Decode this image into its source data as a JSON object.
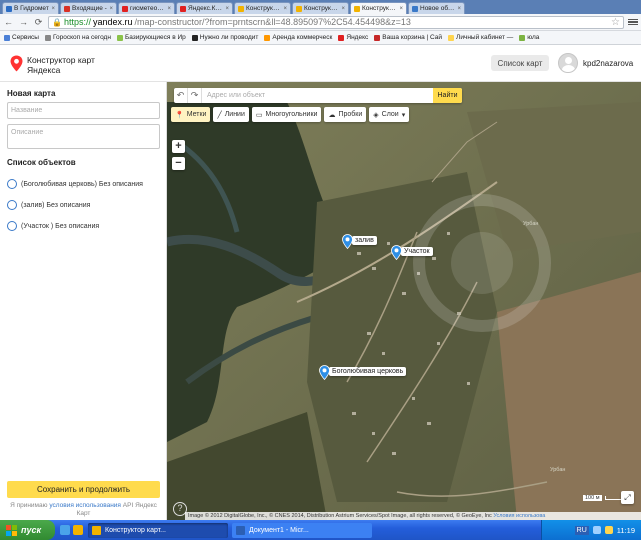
{
  "browser": {
    "tabs": [
      {
        "title": "В Гидромет",
        "favicon_color": "#2b6cc4",
        "active": false
      },
      {
        "title": "Входящие - ",
        "favicon_color": "#d93025",
        "active": false
      },
      {
        "title": "гисметео ул",
        "favicon_color": "#e02020",
        "active": false
      },
      {
        "title": "Яндекс.Карт",
        "favicon_color": "#e02020",
        "active": false
      },
      {
        "title": "Конструктор",
        "favicon_color": "#f2b300",
        "active": false
      },
      {
        "title": "Конструктор",
        "favicon_color": "#f2b300",
        "active": false
      },
      {
        "title": "Конструктор",
        "favicon_color": "#f2b300",
        "active": true
      },
      {
        "title": "Новое объяв",
        "favicon_color": "#3a79c8",
        "active": false
      }
    ],
    "tab_close": "×",
    "url_secure": "https://",
    "url_host": "yandex.ru",
    "url_path": "/map-constructor/?from=prntscrn&ll=48.895097%2C54.454498&z=13",
    "bookmarks": [
      {
        "label": "Сервисы",
        "color": "#4a7fd6"
      },
      {
        "label": "Гороскоп на сегодн",
        "color": "#888888"
      },
      {
        "label": "Базирующиеся в Ир",
        "color": "#8bc34a"
      },
      {
        "label": "Нужно ли проводит",
        "color": "#222222"
      },
      {
        "label": "Аренда коммерческ",
        "color": "#ff9800"
      },
      {
        "label": "Яндекс",
        "color": "#e02020"
      },
      {
        "label": "Ваша корзина | Сай",
        "color": "#c62828"
      },
      {
        "label": "Личный кабинет — ",
        "color": "#ffd54f"
      },
      {
        "label": "юла",
        "color": "#7cb342"
      }
    ]
  },
  "header": {
    "logo_line1": "Конструктор карт",
    "logo_line2": "Яндекса",
    "list_button": "Список карт",
    "username": "kpd2nazarova"
  },
  "sidebar": {
    "title": "Новая карта",
    "name_placeholder": "Название",
    "desc_placeholder": "Описание",
    "objects_title": "Список объектов",
    "objects": [
      {
        "label": "(Боголюбивая церковь) Без описания"
      },
      {
        "label": "(залив) Без описания"
      },
      {
        "label": "(Участок ) Без описания"
      }
    ],
    "save_button": "Сохранить и продолжить",
    "terms_prefix": "Я принимаю",
    "terms_link": "условия использования",
    "terms_suffix": "API Яндекс Карт"
  },
  "map": {
    "search_placeholder": "Адрес или объект",
    "find_button": "Найти",
    "tools": [
      {
        "label": "Метки",
        "icon": "pin-icon",
        "active": true
      },
      {
        "label": "Линии",
        "icon": "line-icon",
        "active": false
      },
      {
        "label": "Многоугольники",
        "icon": "polygon-icon",
        "active": false
      },
      {
        "label": "Пробки",
        "icon": "traffic-icon",
        "active": false
      },
      {
        "label": "Слои",
        "icon": "layers-icon",
        "active": false
      }
    ],
    "markers": [
      {
        "label": "залив"
      },
      {
        "label": "Участок"
      },
      {
        "label": "Боголюбивая церковь"
      }
    ],
    "labels": [
      "Урбан",
      "Урбан"
    ],
    "zoom_in": "+",
    "zoom_out": "−",
    "help": "?",
    "copyright": "Image © 2012 DigitalGlobe, Inc., © CNES 2014, Distribution Astrium Services/Spot Image, all rights reserved, © GeoEye, Inc",
    "copyright_link": "Условия использова",
    "scale_label": "100 м",
    "marker_color": "#2e8fe6"
  },
  "taskbar": {
    "start": "пуск",
    "tasks": [
      {
        "label": "Конструктор карт...",
        "active": true,
        "icon_color": "#f2b300"
      },
      {
        "label": "Документ1 - Micr...",
        "active": false,
        "icon_color": "#2b5fb4"
      }
    ],
    "lang": "RU",
    "clock": "11:19"
  }
}
